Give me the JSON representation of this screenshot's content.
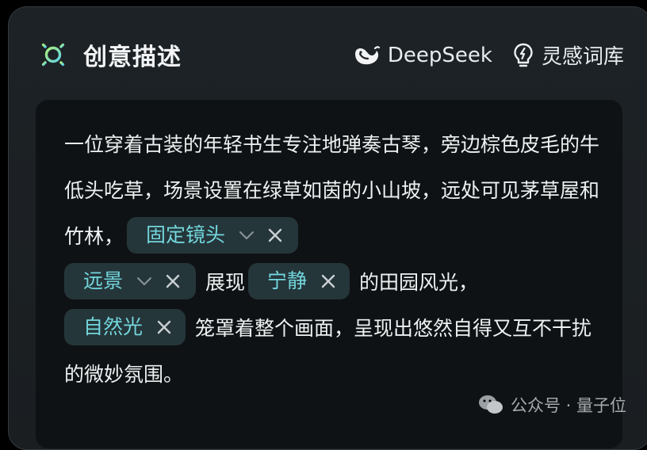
{
  "header": {
    "title": "创意描述",
    "deepseek_label": "DeepSeek",
    "inspiration_label": "灵感词库"
  },
  "description": {
    "text_1": "一位穿着古装的年轻书生专注地弹奏古琴，旁边棕色皮毛的牛低头吃草，场景设置在绿草如茵的小山坡，远处可见茅草屋和竹林，",
    "chip_1": "固定镜头",
    "chip_2": "远景",
    "text_2": "展现",
    "chip_3": "宁静",
    "text_3": "的田园风光，",
    "chip_4": "自然光",
    "text_4": "笼罩着整个画面，呈现出悠然自得又互不干扰的微妙氛围。"
  },
  "watermark": {
    "text": "公众号 · 量子位"
  },
  "colors": {
    "accent": "#72d6dd",
    "chip_bg": "#25363a",
    "card_bg": "#0f1214",
    "panel_bg": "#1d2226"
  },
  "icons": {
    "title_icon": "sun-icon",
    "deepseek_icon": "whale-icon",
    "inspiration_icon": "lightbulb-icon"
  }
}
